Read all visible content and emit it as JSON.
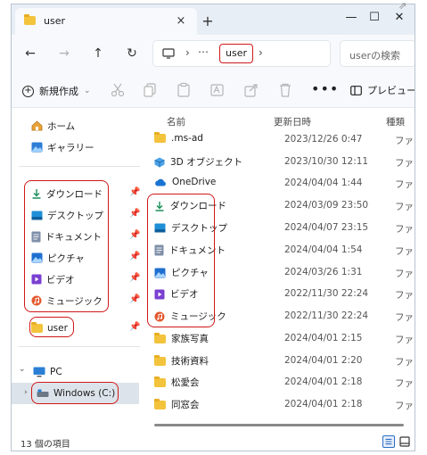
{
  "tab": {
    "title": "user",
    "close": "×",
    "new_tab": "+"
  },
  "window_controls": {
    "minimize": "—",
    "maximize": "☐",
    "close": "✕"
  },
  "corner_glyph": "⇗",
  "nav": {
    "back": "←",
    "forward": "→",
    "up": "↑",
    "refresh": "↻"
  },
  "address": {
    "separator": "›",
    "overflow": "⋯",
    "current": "user",
    "trailing_separator": "›"
  },
  "search": {
    "placeholder": "userの検索"
  },
  "toolbar": {
    "new_label": "新規作成",
    "new_chevron": "⌄",
    "more_label": "•••",
    "preview_label": "プレビュー"
  },
  "sidebar": {
    "quick": [
      {
        "label": "ホーム"
      },
      {
        "label": "ギャラリー"
      }
    ],
    "pinned": [
      {
        "label": "ダウンロード",
        "pin": "📌"
      },
      {
        "label": "デスクトップ",
        "pin": "📌"
      },
      {
        "label": "ドキュメント",
        "pin": "📌"
      },
      {
        "label": "ピクチャ",
        "pin": "📌"
      },
      {
        "label": "ビデオ",
        "pin": "📌"
      },
      {
        "label": "ミュージック",
        "pin": "📌"
      },
      {
        "label": "user",
        "pin": "📌"
      }
    ],
    "pc_label": "PC",
    "drive_label": "Windows (C:)",
    "expander_open": "⌄",
    "expander_closed": "›"
  },
  "columns": {
    "name": "名前",
    "date": "更新日時",
    "type": "種類"
  },
  "files": [
    {
      "name": ".ms-ad",
      "date": "2023/12/26 0:47",
      "type": "ファイル フ",
      "icon": "folder-icon"
    },
    {
      "name": "3D オブジェクト",
      "date": "2023/10/30 12:11",
      "type": "ファイル フ",
      "icon": "cube-icon"
    },
    {
      "name": "OneDrive",
      "date": "2024/04/04 1:44",
      "type": "ファイル フ",
      "icon": "cloud-icon"
    },
    {
      "name": "ダウンロード",
      "date": "2024/03/09 23:50",
      "type": "ファイル フ",
      "icon": "download-icon"
    },
    {
      "name": "デスクトップ",
      "date": "2024/04/07 23:15",
      "type": "ファイル フ",
      "icon": "desktop-icon"
    },
    {
      "name": "ドキュメント",
      "date": "2024/04/04 1:54",
      "type": "ファイル フ",
      "icon": "document-icon"
    },
    {
      "name": "ピクチャ",
      "date": "2024/03/26 1:31",
      "type": "ファイル フ",
      "icon": "picture-icon"
    },
    {
      "name": "ビデオ",
      "date": "2022/11/30 22:24",
      "type": "ファイル フ",
      "icon": "video-icon"
    },
    {
      "name": "ミュージック",
      "date": "2022/11/30 22:24",
      "type": "ファイル フ",
      "icon": "music-icon"
    },
    {
      "name": "家族写真",
      "date": "2024/04/01 2:15",
      "type": "ファイル フ",
      "icon": "folder-icon"
    },
    {
      "name": "技術資料",
      "date": "2024/04/01 2:20",
      "type": "ファイル フ",
      "icon": "folder-icon"
    },
    {
      "name": "松愛会",
      "date": "2024/04/01 2:18",
      "type": "ファイル フ",
      "icon": "folder-icon"
    },
    {
      "name": "同窓会",
      "date": "2024/04/01 2:18",
      "type": "ファイル フ",
      "icon": "folder-icon"
    }
  ],
  "status": {
    "item_count": "13 個の項目"
  },
  "colors": {
    "annotation": "#d01818",
    "accent": "#2b6ec7",
    "folder": "#f3c33c"
  }
}
